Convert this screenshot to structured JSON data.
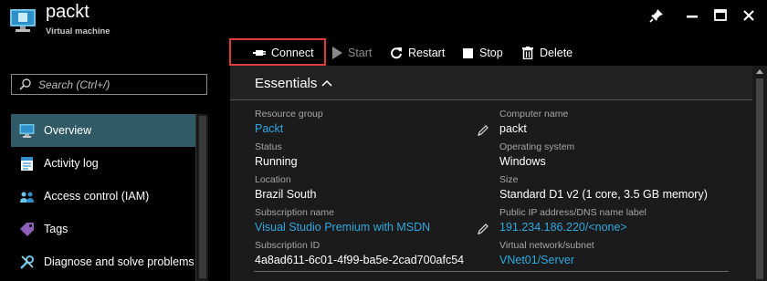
{
  "header": {
    "title": "packt",
    "subtitle": "Virtual machine"
  },
  "toolbar": {
    "connect": "Connect",
    "start": "Start",
    "restart": "Restart",
    "stop": "Stop",
    "delete": "Delete"
  },
  "search": {
    "placeholder": "Search (Ctrl+/)"
  },
  "nav": [
    {
      "label": "Overview",
      "icon": "monitor-icon"
    },
    {
      "label": "Activity log",
      "icon": "activity-log-icon"
    },
    {
      "label": "Access control (IAM)",
      "icon": "people-icon"
    },
    {
      "label": "Tags",
      "icon": "tag-icon"
    },
    {
      "label": "Diagnose and solve problems",
      "icon": "wrench-icon"
    }
  ],
  "essentials": {
    "title": "Essentials",
    "left": [
      {
        "label": "Resource group",
        "value": "Packt"
      },
      {
        "label": "Status",
        "value": "Running"
      },
      {
        "label": "Location",
        "value": "Brazil South"
      },
      {
        "label": "Subscription name",
        "value": "Visual Studio Premium with MSDN"
      },
      {
        "label": "Subscription ID",
        "value": "4a8ad611-6c01-4f99-ba5e-2cad700afc54"
      }
    ],
    "right": [
      {
        "label": "Computer name",
        "value": "packt"
      },
      {
        "label": "Operating system",
        "value": "Windows"
      },
      {
        "label": "Size",
        "value": "Standard D1 v2 (1 core, 3.5 GB memory)"
      },
      {
        "label": "Public IP address/DNS name label",
        "value": "191.234.186.220/<none>"
      },
      {
        "label": "Virtual network/subnet",
        "value": "VNet01/Server"
      }
    ]
  },
  "colors": {
    "accent_link": "#2da8e0",
    "highlight_box": "#e23b3b",
    "active_nav": "#2f5a66"
  }
}
